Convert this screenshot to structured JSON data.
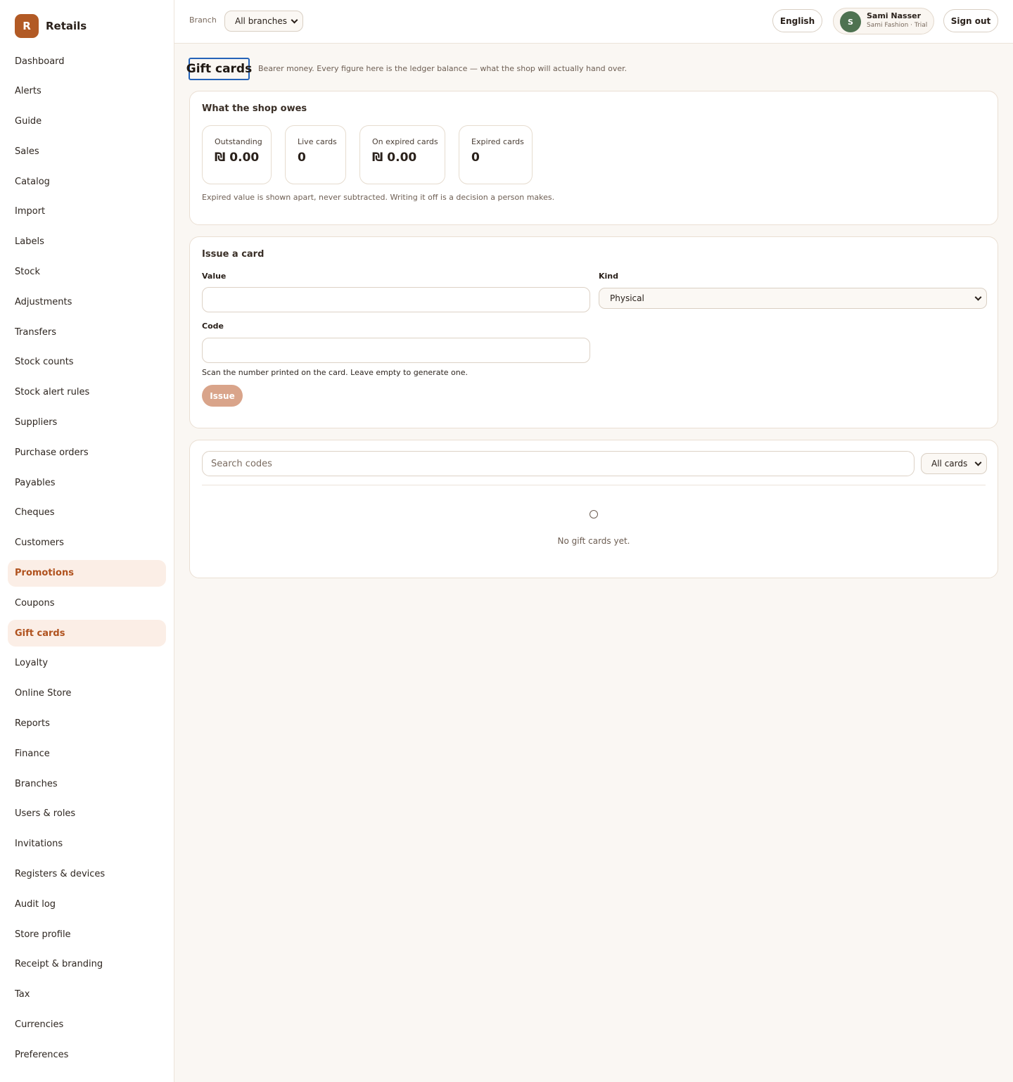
{
  "brand": {
    "logo_letter": "R",
    "name": "Retails"
  },
  "sidebar": {
    "items": [
      {
        "label": "Dashboard"
      },
      {
        "label": "Alerts"
      },
      {
        "label": "Guide"
      },
      {
        "label": "Sales"
      },
      {
        "label": "Catalog"
      },
      {
        "label": "Import"
      },
      {
        "label": "Labels"
      },
      {
        "label": "Stock"
      },
      {
        "label": "Adjustments"
      },
      {
        "label": "Transfers"
      },
      {
        "label": "Stock counts"
      },
      {
        "label": "Stock alert rules"
      },
      {
        "label": "Suppliers"
      },
      {
        "label": "Purchase orders"
      },
      {
        "label": "Payables"
      },
      {
        "label": "Cheques"
      },
      {
        "label": "Customers"
      },
      {
        "label": "Promotions",
        "active": true
      },
      {
        "label": "Coupons"
      },
      {
        "label": "Gift cards",
        "active": true
      },
      {
        "label": "Loyalty"
      },
      {
        "label": "Online Store"
      },
      {
        "label": "Reports"
      },
      {
        "label": "Finance"
      },
      {
        "label": "Branches"
      },
      {
        "label": "Users & roles"
      },
      {
        "label": "Invitations"
      },
      {
        "label": "Registers & devices"
      },
      {
        "label": "Audit log"
      },
      {
        "label": "Store profile"
      },
      {
        "label": "Receipt & branding"
      },
      {
        "label": "Tax"
      },
      {
        "label": "Currencies"
      },
      {
        "label": "Preferences"
      }
    ]
  },
  "topbar": {
    "branch_label": "Branch",
    "branch_value": "All branches",
    "language": "English",
    "user": {
      "initial": "S",
      "name": "Sami Nasser",
      "org": "Sami Fashion · Trial"
    },
    "sign_out": "Sign out"
  },
  "page": {
    "title": "Gift cards",
    "subtitle": "Bearer money. Every figure here is the ledger balance — what the shop will actually hand over."
  },
  "owes": {
    "title": "What the shop owes",
    "stats": [
      {
        "label": "Outstanding",
        "value": "₪ 0.00"
      },
      {
        "label": "Live cards",
        "value": "0"
      },
      {
        "label": "On expired cards",
        "value": "₪ 0.00"
      },
      {
        "label": "Expired cards",
        "value": "0"
      }
    ],
    "note": "Expired value is shown apart, never subtracted. Writing it off is a decision a person makes."
  },
  "issue": {
    "title": "Issue a card",
    "value_label": "Value",
    "value_input": "",
    "kind_label": "Kind",
    "kind_value": "Physical",
    "code_label": "Code",
    "code_input": "",
    "help": "Scan the number printed on the card. Leave empty to generate one.",
    "button": "Issue"
  },
  "list": {
    "search_placeholder": "Search codes",
    "filter_value": "All cards",
    "empty_text": "No gift cards yet."
  },
  "colors": {
    "accent": "#b25a25",
    "active_bg": "#fbeee6",
    "avatar": "#4e7251",
    "issue_button": "#d9a48a"
  }
}
